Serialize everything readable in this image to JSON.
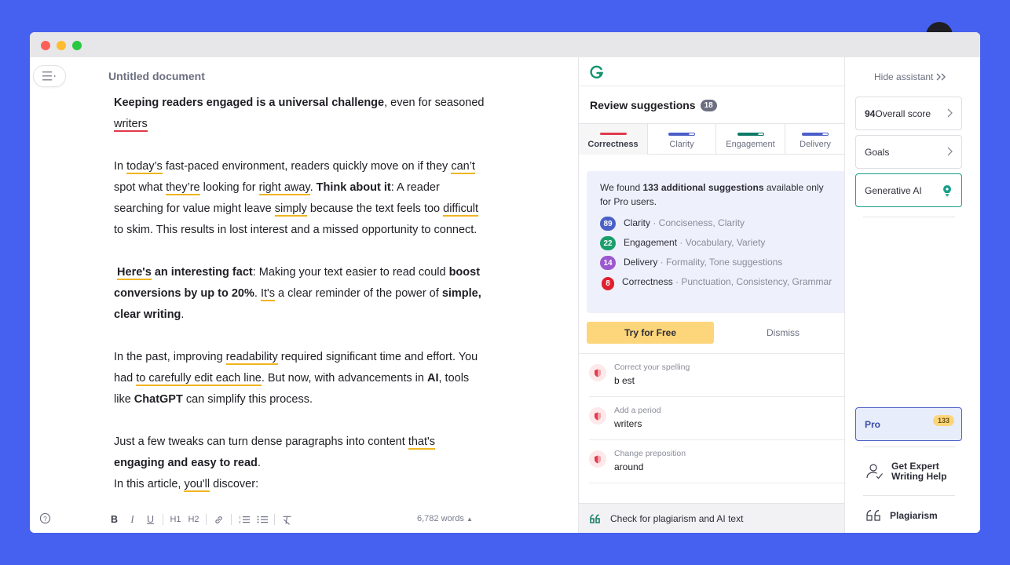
{
  "document": {
    "title": "Untitled document",
    "word_count": "6,782 words"
  },
  "body": {
    "p1_b": "Keeping readers engaged is a universal challenge",
    "p1_a": ", even for seasoned",
    "p1_c": "writers",
    "p2_a": "In ",
    "p2_today": "today’s",
    "p2_b": " fast-paced environment, readers quickly move on if they ",
    "p2_cant": "can’t",
    "p2_c": "spot what ",
    "p2_theyre": "they’re",
    "p2_d": " looking for ",
    "p2_right": "right away",
    "p2_e": ". ",
    "p2_think": "Think about it",
    "p2_f": ": A reader",
    "p2_g": "searching for value might leave ",
    "p2_simply": "simply",
    "p2_h": " because the text feels too ",
    "p2_difficult": "difficult",
    "p2_i": "to skim. This results in lost interest and a missed opportunity to connect.",
    "p3_heres": "Here's",
    "p3_b1": " an interesting fact",
    "p3_a": ": Making your text easier to read could ",
    "p3_boost": "boost",
    "p3_conv": "conversions by up to 20%",
    "p3_c": ". ",
    "p3_its": "It's",
    "p3_d": " a clear reminder of the power of ",
    "p3_simple": "simple,",
    "p3_clear": "clear writing",
    "p3_e": ".",
    "p4_a": "In the past, improving ",
    "p4_readability": "readability",
    "p4_b": " required significant time and effort. You",
    "p4_c": "had ",
    "p4_carefully": "to carefully edit each line",
    "p4_d": ". But now, with advancements in ",
    "p4_ai": "AI",
    "p4_e": ", tools",
    "p4_f": "like ",
    "p4_chatgpt": "ChatGPT",
    "p4_g": " can simplify this process.",
    "p5_a": "Just a few tweaks can turn dense paragraphs into content ",
    "p5_thats": "that's",
    "p5_b": "engaging and easy to read",
    "p5_c": ".",
    "p6_a": "In this article, ",
    "p6_youll": "you'll",
    "p6_b": " discover:"
  },
  "toolbar": {
    "bold": "B",
    "italic": "I",
    "underline": "U",
    "h1": "H1",
    "h2": "H2"
  },
  "panel": {
    "review_title": "Review suggestions",
    "review_count": "18",
    "tabs": [
      {
        "label": "Correctness",
        "color": "#e23a4b"
      },
      {
        "label": "Clarity",
        "color": "#4b5fc8"
      },
      {
        "label": "Engagement",
        "color": "#0e7a66"
      },
      {
        "label": "Delivery",
        "color": "#4b5fc8"
      }
    ],
    "pro_text_a": "We found ",
    "pro_text_b": "133 additional suggestions",
    "pro_text_c": " available only for Pro users.",
    "pro_items": [
      {
        "count": "89",
        "name": "Clarity",
        "sub": " · Conciseness, Clarity",
        "color": "#4b5fc8"
      },
      {
        "count": "22",
        "name": "Engagement",
        "sub": " · Vocabulary, Variety",
        "color": "#1a9e6c"
      },
      {
        "count": "14",
        "name": "Delivery",
        "sub": " · Formality, Tone suggestions",
        "color": "#9b59d0"
      },
      {
        "count": "8",
        "name": "Correctness",
        "sub": " · Punctuation, Consistency, Grammar",
        "color": "#e0202f"
      }
    ],
    "try_label": "Try for Free",
    "dismiss_label": "Dismiss",
    "cards": [
      {
        "type": "Correct your spelling",
        "word": "b est"
      },
      {
        "type": "Add a period",
        "word": "writers"
      },
      {
        "type": "Change preposition",
        "word": "around"
      }
    ],
    "check_label": "Check for plagiarism and AI text"
  },
  "rail": {
    "hide_label": "Hide assistant",
    "score_value": "94",
    "score_label": " Overall score",
    "goals_label": "Goals",
    "genai_label": "Generative AI",
    "pro_label": "Pro",
    "pro_count": "133",
    "expert_line1": "Get Expert",
    "expert_line2": "Writing Help",
    "plagiarism_label": "Plagiarism"
  }
}
